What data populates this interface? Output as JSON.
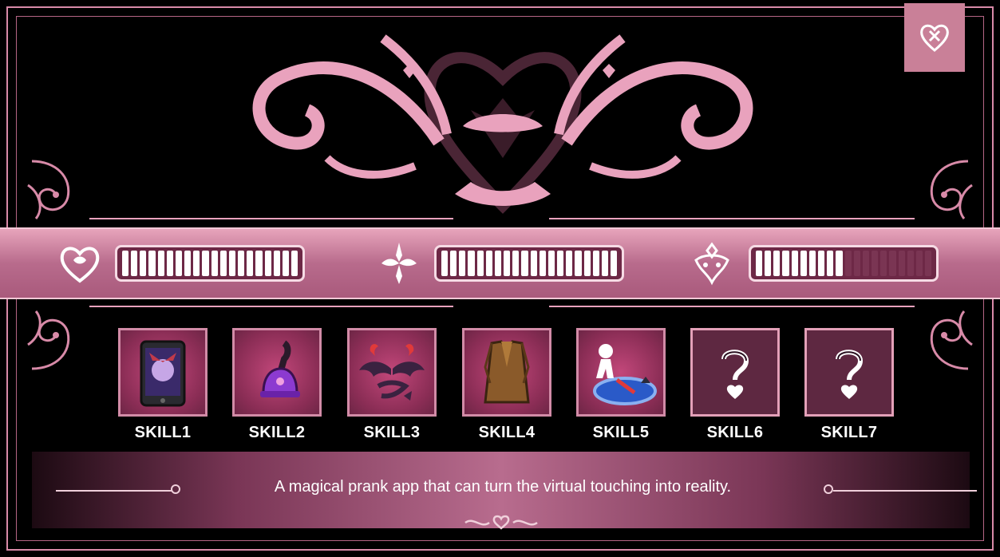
{
  "stats": {
    "bars": [
      {
        "name": "heart",
        "value": 1.0
      },
      {
        "name": "fleur",
        "value": 1.0
      },
      {
        "name": "crest",
        "value": 0.5
      }
    ],
    "segments": 20
  },
  "skills": [
    {
      "label": "SKILL1",
      "icon": "phone-demon-icon",
      "known": true
    },
    {
      "label": "SKILL2",
      "icon": "purple-bell-icon",
      "known": true
    },
    {
      "label": "SKILL3",
      "icon": "devil-wings-horns-icon",
      "known": true
    },
    {
      "label": "SKILL4",
      "icon": "brown-coat-icon",
      "known": true
    },
    {
      "label": "SKILL5",
      "icon": "portal-figure-icon",
      "known": true
    },
    {
      "label": "SKILL6",
      "icon": "question-heart-icon",
      "known": false
    },
    {
      "label": "SKILL7",
      "icon": "question-heart-icon",
      "known": false
    }
  ],
  "description": "A magical prank app that can turn the virtual touching into reality.",
  "colors": {
    "accent": "#d88aa8",
    "band": "#b86b8c",
    "background": "#000000"
  }
}
